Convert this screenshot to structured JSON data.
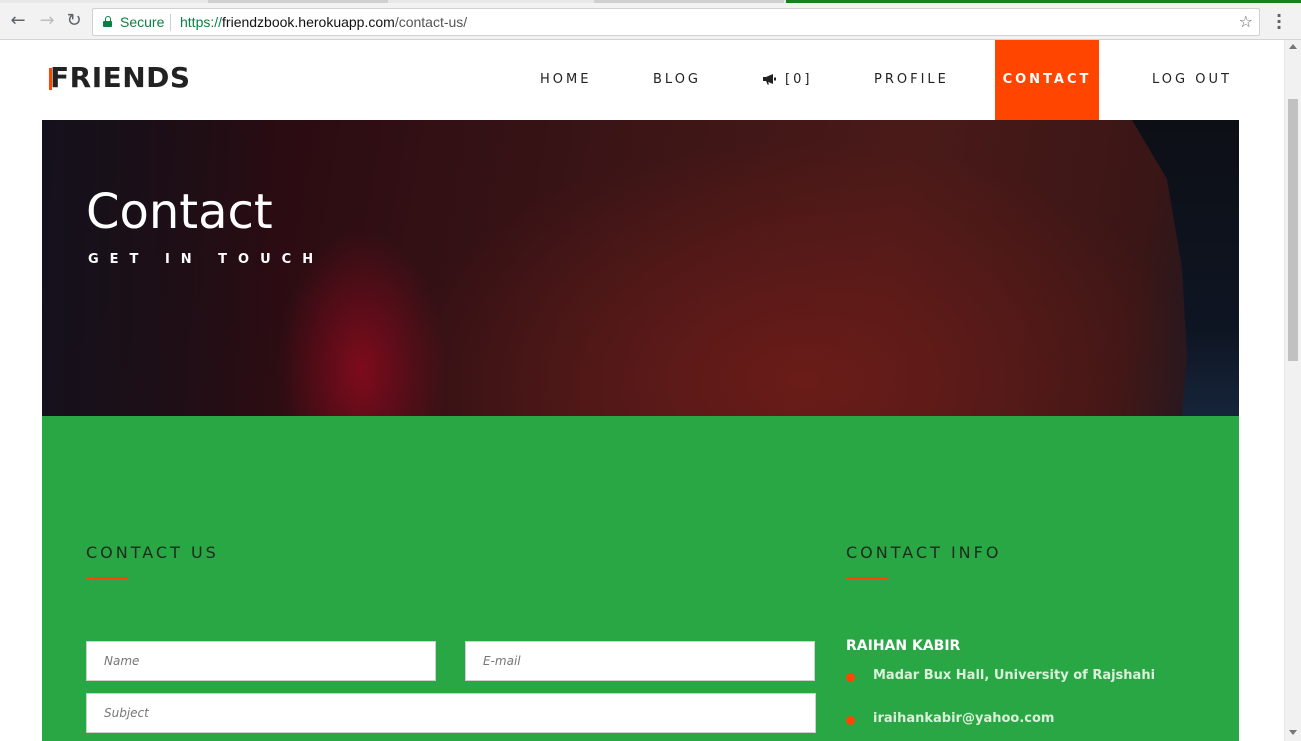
{
  "browser": {
    "secure_label": "Secure",
    "url_scheme": "https://",
    "url_host": "friendzbook.herokuapp.com",
    "url_path": "/contact-us/",
    "back_icon": "arrow-left-icon",
    "forward_icon": "arrow-right-icon",
    "reload_icon": "reload-icon",
    "bookmark_icon": "star-icon",
    "menu_icon": "kebab-menu-icon"
  },
  "site": {
    "logo": "FRIENDS",
    "nav": [
      {
        "label": "HOME"
      },
      {
        "label": "BLOG"
      },
      {
        "label": "[0]",
        "icon": "megaphone-icon"
      },
      {
        "label": "PROFILE"
      },
      {
        "label": "CONTACT",
        "active": true
      },
      {
        "label": "LOG OUT"
      }
    ]
  },
  "hero": {
    "title": "Contact",
    "subtitle": "GET IN TOUCH"
  },
  "contact_form": {
    "heading": "CONTACT US",
    "name_placeholder": "Name",
    "email_placeholder": "E-mail",
    "subject_placeholder": "Subject"
  },
  "contact_info": {
    "heading": "CONTACT INFO",
    "name": "RAIHAN KABIR",
    "address": "Madar Bux Hall, University of Rajshahi",
    "email": "iraihankabir@yahoo.com"
  },
  "colors": {
    "accent": "#ff4500",
    "section_green": "#29a744",
    "secure_green": "#0b8043"
  }
}
